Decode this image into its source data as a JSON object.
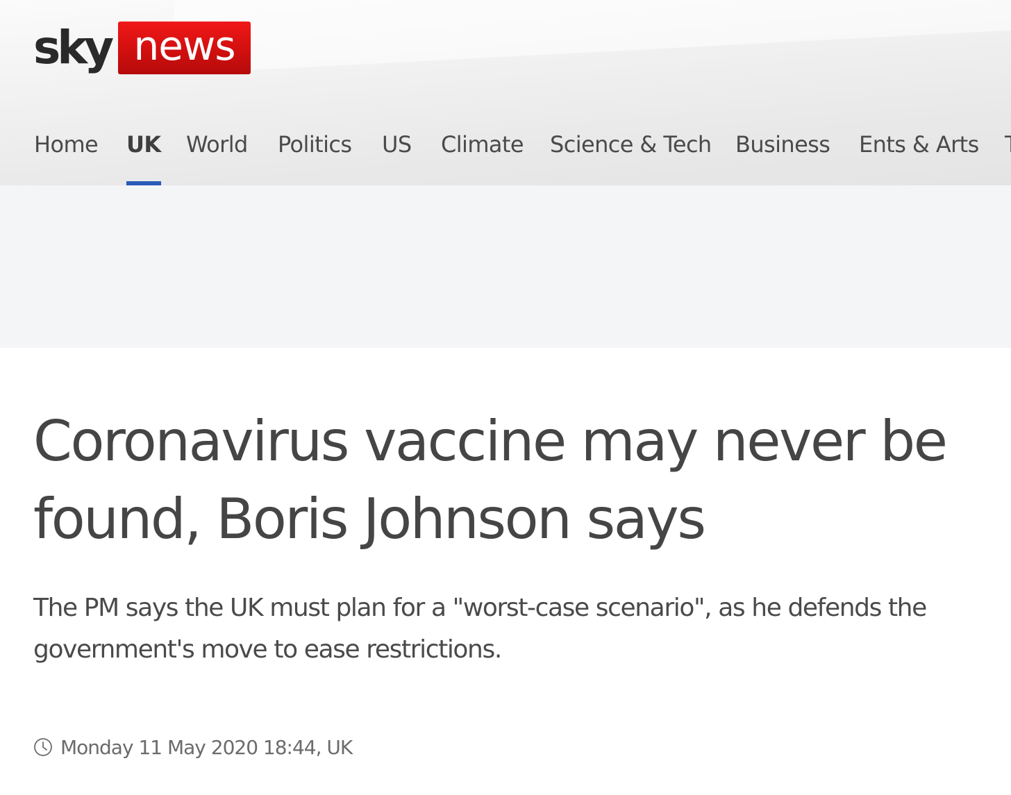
{
  "brand": {
    "logo_sky": "sky",
    "logo_news": "news",
    "logo_red": "#d4111b"
  },
  "nav": {
    "items": [
      {
        "label": "Home",
        "active": false
      },
      {
        "label": "UK",
        "active": true
      },
      {
        "label": "World",
        "active": false
      },
      {
        "label": "Politics",
        "active": false
      },
      {
        "label": "US",
        "active": false
      },
      {
        "label": "Climate",
        "active": false
      },
      {
        "label": "Science & Tech",
        "active": false
      },
      {
        "label": "Business",
        "active": false
      },
      {
        "label": "Ents & Arts",
        "active": false
      },
      {
        "label": "T",
        "active": false
      }
    ],
    "active_color": "#2a5ab8"
  },
  "article": {
    "headline": "Coronavirus vaccine may never be found, Boris Johnson says",
    "standfirst": "The PM says the UK must plan for a \"worst-case scenario\", as he defends the government's move to ease restrictions.",
    "timestamp": "Monday 11 May 2020 18:44, UK",
    "timestamp_icon": "clock-icon"
  }
}
